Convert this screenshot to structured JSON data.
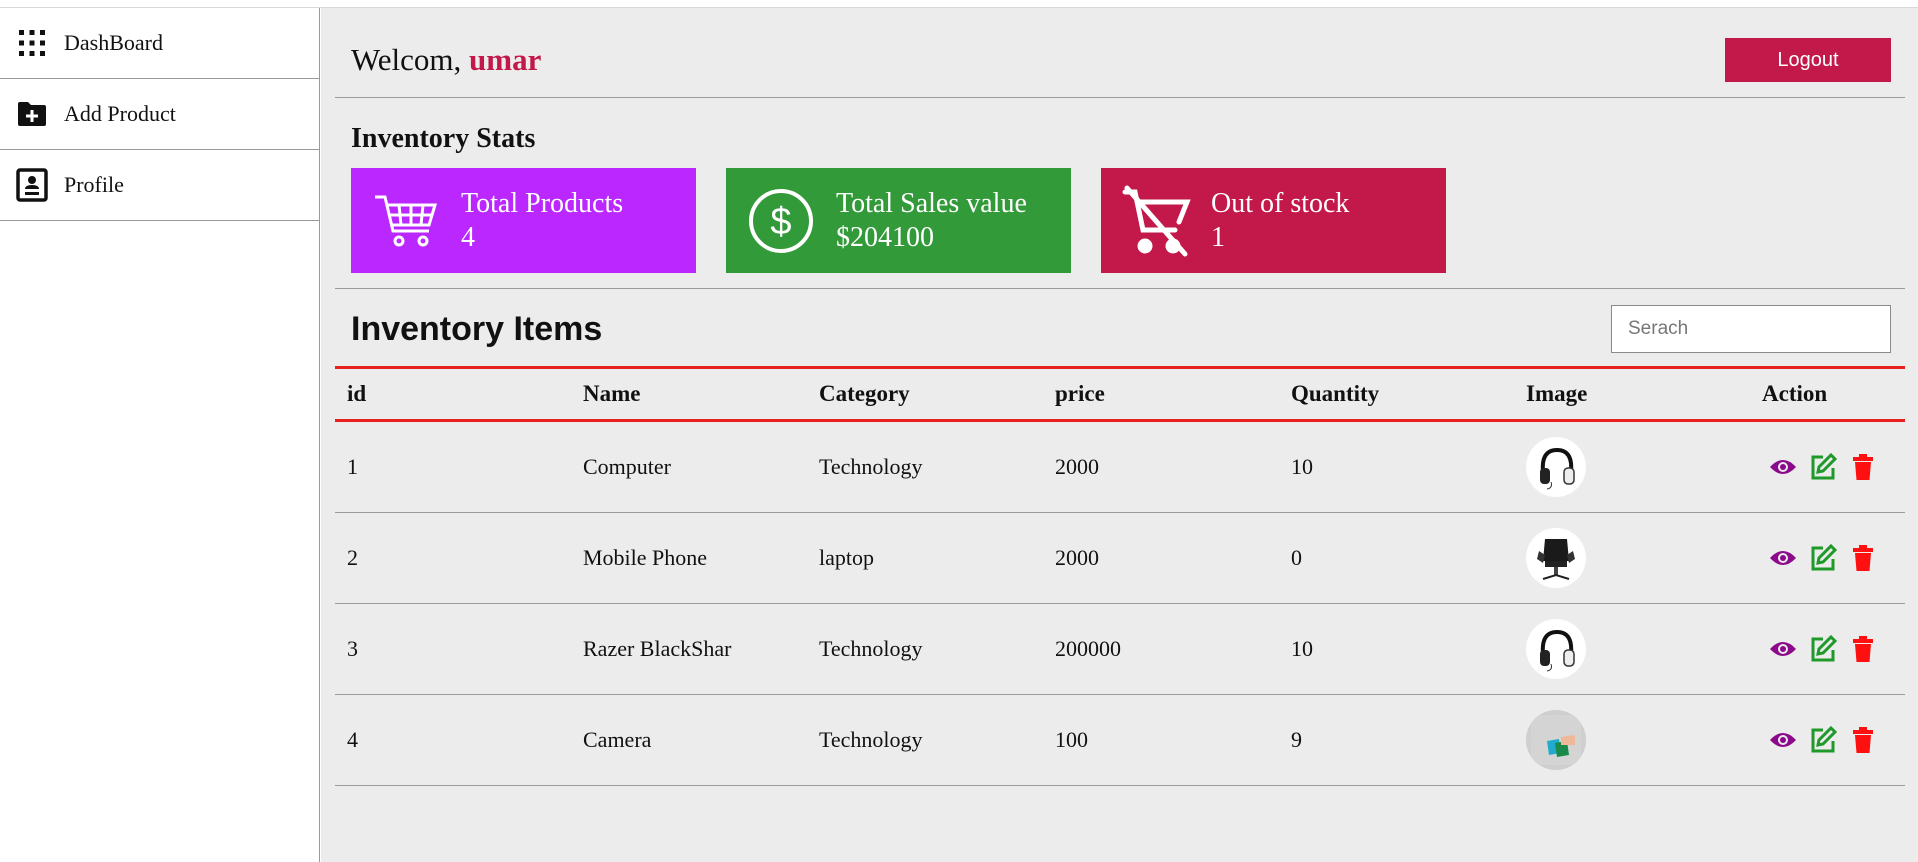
{
  "sidebar": {
    "items": [
      {
        "label": "DashBoard",
        "icon": "grid-icon"
      },
      {
        "label": "Add Product",
        "icon": "folder-plus-icon"
      },
      {
        "label": "Profile",
        "icon": "profile-card-icon"
      }
    ]
  },
  "header": {
    "greeting": "Welcom,",
    "username": "umar",
    "logout_label": "Logout"
  },
  "stats": {
    "title": "Inventory Stats",
    "cards": [
      {
        "label": "Total Products",
        "value": "4",
        "color": "#bb27ff",
        "icon": "cart-icon"
      },
      {
        "label": "Total Sales value",
        "value": "$204100",
        "color": "#339a3a",
        "icon": "dollar-icon"
      },
      {
        "label": "Out of stock",
        "value": "1",
        "color": "#c2184a",
        "icon": "cart-off-icon"
      }
    ]
  },
  "inventory": {
    "title": "Inventory Items",
    "search_placeholder": "Serach",
    "columns": [
      "id",
      "Name",
      "Category",
      "price",
      "Quantity",
      "Image",
      "Action"
    ],
    "rows": [
      {
        "id": "1",
        "name": "Computer",
        "category": "Technology",
        "price": "2000",
        "quantity": "10",
        "image": "headphones"
      },
      {
        "id": "2",
        "name": "Mobile Phone",
        "category": "laptop",
        "price": "2000",
        "quantity": "0",
        "image": "gaming-chair"
      },
      {
        "id": "3",
        "name": "Razer BlackShar",
        "category": "Technology",
        "price": "200000",
        "quantity": "10",
        "image": "headphones"
      },
      {
        "id": "4",
        "name": "Camera",
        "category": "Technology",
        "price": "100",
        "quantity": "9",
        "image": "shopping-bags"
      }
    ]
  },
  "colors": {
    "accent": "#c2184a",
    "view": "#8b0a8b",
    "edit": "#1f9a2a",
    "delete": "#ff1010",
    "table_rule": "#e8201f"
  }
}
